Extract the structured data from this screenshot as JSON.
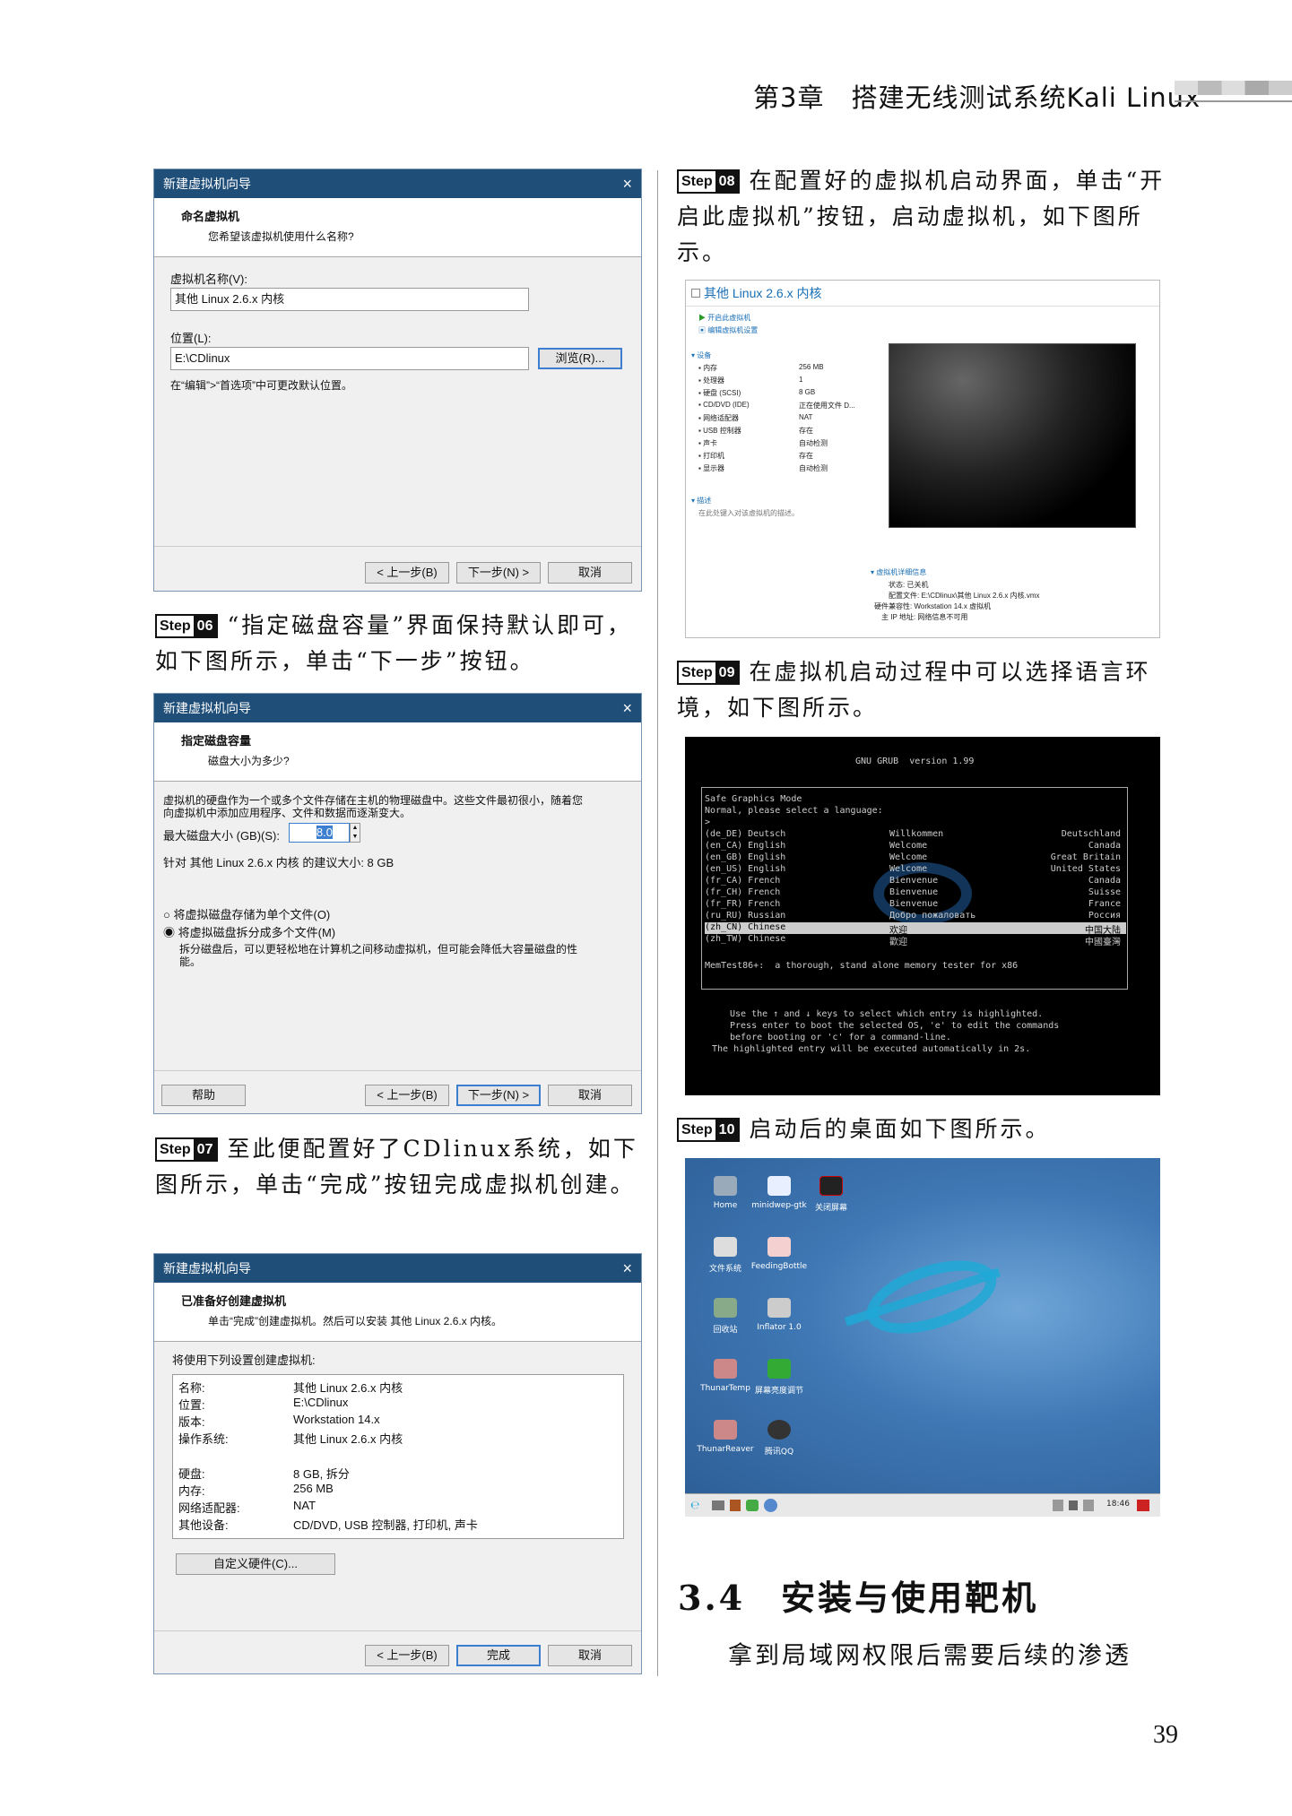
{
  "header": {
    "chapter_title": "第3章　搭建无线测试系统Kali Linux"
  },
  "page_number": "39",
  "steps": {
    "s06": {
      "word": "Step",
      "num": "06",
      "text": "“指定磁盘容量”界面保持默认即可，如下图所示，单击“下一步”按钮。"
    },
    "s07": {
      "word": "Step",
      "num": "07",
      "text": "至此便配置好了CDlinux系统，如下图所示，单击“完成”按钮完成虚拟机创建。"
    },
    "s08": {
      "word": "Step",
      "num": "08",
      "text": "在配置好的虚拟机启动界面，单击“开启此虚拟机”按钮，启动虚拟机，如下图所示。"
    },
    "s09": {
      "word": "Step",
      "num": "09",
      "text": "在虚拟机启动过程中可以选择语言环境，如下图所示。"
    },
    "s10": {
      "word": "Step",
      "num": "10",
      "text": "启动后的桌面如下图所示。"
    }
  },
  "section": {
    "number": "3.4",
    "title": "安装与使用靶机"
  },
  "last_line": "拿到局域网权限后需要后续的渗透",
  "wizard1": {
    "title": "新建虚拟机向导",
    "close": "×",
    "heading": "命名虚拟机",
    "subheading": "您希望该虚拟机使用什么名称?",
    "name_label": "虚拟机名称(V):",
    "name_value": "其他 Linux 2.6.x 内核",
    "loc_label": "位置(L):",
    "loc_value": "E:\\CDlinux",
    "browse": "浏览(R)...",
    "hint": "在“编辑”>“首选项”中可更改默认位置。",
    "back": "< 上一步(B)",
    "next": "下一步(N) >",
    "cancel": "取消"
  },
  "wizard2": {
    "title": "新建虚拟机向导",
    "close": "×",
    "heading": "指定磁盘容量",
    "subheading": "磁盘大小为多少?",
    "desc1": "虚拟机的硬盘作为一个或多个文件存储在主机的物理磁盘中。这些文件最初很小，随着您",
    "desc2": "向虚拟机中添加应用程序、文件和数据而逐渐变大。",
    "max_label": "最大磁盘大小 (GB)(S):",
    "max_value": "8.0",
    "recommend": "针对 其他 Linux 2.6.x 内核 的建议大小: 8 GB",
    "radio1": "将虚拟磁盘存储为单个文件(O)",
    "radio2": "将虚拟磁盘拆分成多个文件(M)",
    "radio2_desc1": "拆分磁盘后，可以更轻松地在计算机之间移动虚拟机，但可能会降低大容量磁盘的性",
    "radio2_desc2": "能。",
    "help": "帮助",
    "back": "< 上一步(B)",
    "next": "下一步(N) >",
    "cancel": "取消"
  },
  "wizard3": {
    "title": "新建虚拟机向导",
    "close": "×",
    "heading": "已准备好创建虚拟机",
    "subheading": "单击“完成”创建虚拟机。然后可以安装 其他 Linux 2.6.x 内核。",
    "intro": "将使用下列设置创建虚拟机:",
    "rows": [
      {
        "k": "名称:",
        "v": "其他 Linux 2.6.x 内核"
      },
      {
        "k": "位置:",
        "v": "E:\\CDlinux"
      },
      {
        "k": "版本:",
        "v": "Workstation 14.x"
      },
      {
        "k": "操作系统:",
        "v": "其他 Linux 2.6.x 内核"
      },
      {
        "k": "",
        "v": ""
      },
      {
        "k": "硬盘:",
        "v": "8 GB, 拆分"
      },
      {
        "k": "内存:",
        "v": "256 MB"
      },
      {
        "k": "网络适配器:",
        "v": "NAT"
      },
      {
        "k": "其他设备:",
        "v": "CD/DVD, USB 控制器, 打印机, 声卡"
      }
    ],
    "customize": "自定义硬件(C)...",
    "back": "< 上一步(B)",
    "finish": "完成",
    "cancel": "取消"
  },
  "vmpanel": {
    "title": "其他 Linux 2.6.x 内核",
    "power_on": "开启此虚拟机",
    "edit": "编辑虚拟机设置",
    "devices_head": "▾ 设备",
    "devices": [
      {
        "k": "内存",
        "v": "256 MB"
      },
      {
        "k": "处理器",
        "v": "1"
      },
      {
        "k": "硬盘 (SCSI)",
        "v": "8 GB"
      },
      {
        "k": "CD/DVD (IDE)",
        "v": "正在使用文件 D..."
      },
      {
        "k": "网络适配器",
        "v": "NAT"
      },
      {
        "k": "USB 控制器",
        "v": "存在"
      },
      {
        "k": "声卡",
        "v": "自动检测"
      },
      {
        "k": "打印机",
        "v": "存在"
      },
      {
        "k": "显示器",
        "v": "自动检测"
      }
    ],
    "desc_head": "▾ 描述",
    "desc_text": "在此处键入对该虚拟机的描述。",
    "details_head": "▾ 虚拟机详细信息",
    "details": [
      {
        "k": "状态:",
        "v": "已关机"
      },
      {
        "k": "配置文件:",
        "v": "E:\\CDlinux\\其他 Linux 2.6.x 内核.vmx"
      },
      {
        "k": "硬件兼容性:",
        "v": "Workstation 14.x 虚拟机"
      },
      {
        "k": "主 IP 地址:",
        "v": "网络信息不可用"
      }
    ]
  },
  "grub": {
    "version": "GNU GRUB  version 1.99",
    "l1": "Safe Graphics Mode",
    "l2": "Normal, please select a language:",
    "l3": ">",
    "entries": [
      {
        "code": "(de_DE) Deutsch",
        "native": "Willkommen",
        "country": "Deutschland"
      },
      {
        "code": "(en_CA) English",
        "native": "Welcome",
        "country": "Canada"
      },
      {
        "code": "(en_GB) English",
        "native": "Welcome",
        "country": "Great Britain"
      },
      {
        "code": "(en_US) English",
        "native": "Welcome",
        "country": "United States"
      },
      {
        "code": "(fr_CA) French",
        "native": "Bienvenue",
        "country": "Canada"
      },
      {
        "code": "(fr_CH) French",
        "native": "Bienvenue",
        "country": "Suisse"
      },
      {
        "code": "(fr_FR) French",
        "native": "Bienvenue",
        "country": "France"
      },
      {
        "code": "(ru_RU) Russian",
        "native": "Добро пожаловать",
        "country": "Россия"
      },
      {
        "code": "(zh_CN) Chinese",
        "native": "欢迎",
        "country": "中国大陆"
      },
      {
        "code": "(zh_TW) Chinese",
        "native": "歡迎",
        "country": "中國臺灣"
      }
    ],
    "memtest": "MemTest86+:  a thorough, stand alone memory tester for x86",
    "help1": "Use the ↑ and ↓ keys to select which entry is highlighted.",
    "help2": "Press enter to boot the selected OS, 'e' to edit the commands",
    "help3": "before booting or 'c' for a command-line.",
    "help4": "The highlighted entry will be executed automatically in 2s."
  },
  "desktop": {
    "icons": [
      {
        "label": "Home"
      },
      {
        "label": "minidwep-gtk"
      },
      {
        "label": "关闭屏幕"
      },
      {
        "label": "文件系统"
      },
      {
        "label": "FeedingBottle"
      },
      {
        "label": "回收站"
      },
      {
        "label": "Inflator 1.0"
      },
      {
        "label": "ThunarTemp"
      },
      {
        "label": "屏幕亮度调节"
      },
      {
        "label": "ThunarReaver"
      },
      {
        "label": "腾讯QQ"
      }
    ],
    "clock": "18:46"
  }
}
